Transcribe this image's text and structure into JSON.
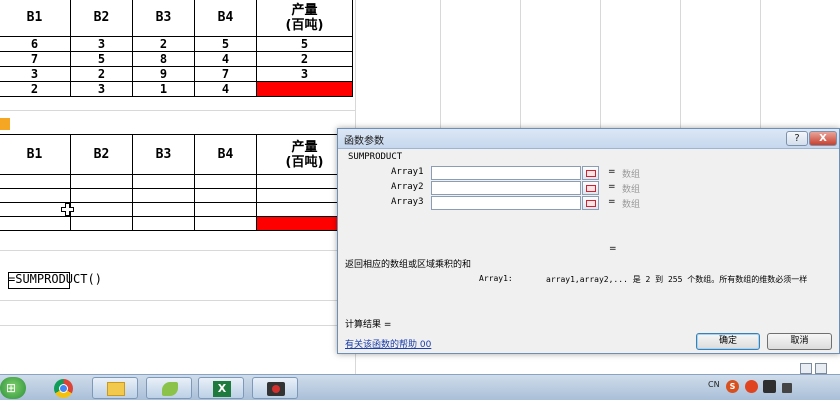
{
  "table_top": {
    "headers": [
      "B1",
      "B2",
      "B3",
      "B4",
      "产量",
      "(百吨)"
    ],
    "rows": [
      [
        "6",
        "3",
        "2",
        "5",
        "5"
      ],
      [
        "7",
        "5",
        "8",
        "4",
        "2"
      ],
      [
        "3",
        "2",
        "9",
        "7",
        "3"
      ],
      [
        "2",
        "3",
        "1",
        "4",
        ""
      ]
    ]
  },
  "table_bottom": {
    "headers": [
      "B1",
      "B2",
      "B3",
      "B4",
      "产量",
      "(百吨)"
    ]
  },
  "formula": "=SUMPRODUCT()",
  "dialog": {
    "title": "函数参数",
    "help_btn": "?",
    "close_btn": "X",
    "function_name": "SUMPRODUCT",
    "args": [
      {
        "label": "Array1",
        "eq": "=",
        "type": "数组"
      },
      {
        "label": "Array2",
        "eq": "=",
        "type": "数组"
      },
      {
        "label": "Array3",
        "eq": "=",
        "type": "数组"
      }
    ],
    "result_eq": "=",
    "description": "返回相应的数组或区域乘积的和",
    "arg_desc_label": "Array1:",
    "arg_desc_text": "array1,array2,... 是 2 到 255 个数组。所有数组的维数必须一样",
    "calc_result": "计算结果 =",
    "help_link": "有关该函数的帮助 00",
    "ok": "确定",
    "cancel": "取消"
  },
  "taskbar": {
    "lang": "CN",
    "tray_s": "S",
    "excel_glyph": "X"
  },
  "colors": {
    "highlight_red": "#ff0000",
    "marker_orange": "#f5a623"
  },
  "icons": [
    "start-orb-icon",
    "chrome-icon",
    "folder-icon",
    "leaf-icon",
    "excel-icon",
    "recorder-icon",
    "cell-reference-icon",
    "cross-cursor-icon"
  ]
}
